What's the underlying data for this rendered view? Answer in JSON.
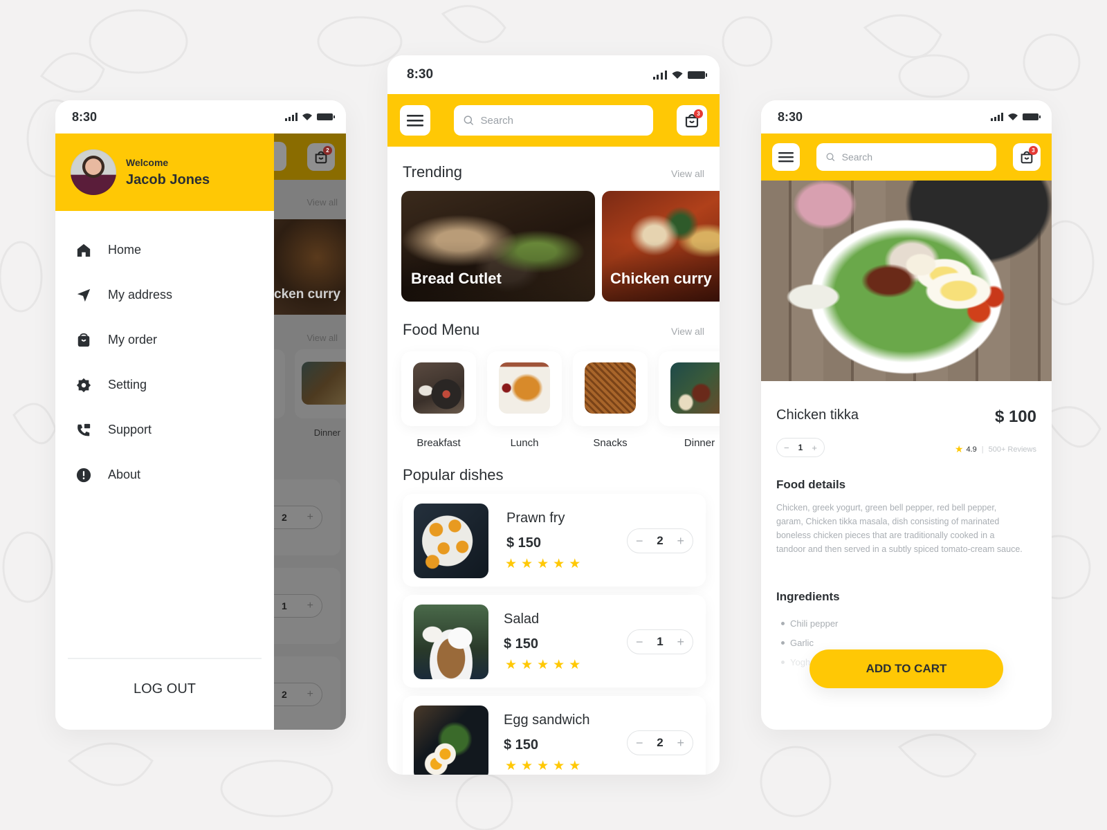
{
  "colors": {
    "accent": "#ffc805",
    "badge": "#e53935",
    "text": "#2b2f33",
    "muted": "#a4a8ac"
  },
  "status": {
    "time": "8:30"
  },
  "drawer_screen": {
    "welcome": "Welcome",
    "user_name": "Jacob Jones",
    "menu": [
      {
        "icon": "home-icon",
        "label": "Home"
      },
      {
        "icon": "navigation-arrow-icon",
        "label": "My address"
      },
      {
        "icon": "shopping-bag-icon",
        "label": "My order"
      },
      {
        "icon": "gear-icon",
        "label": "Setting"
      },
      {
        "icon": "support-phone-icon",
        "label": "Support"
      },
      {
        "icon": "info-exclamation-icon",
        "label": "About"
      }
    ],
    "logout": "LOG OUT",
    "behind": {
      "view_all_1": "View all",
      "view_all_2": "View all",
      "trending_partial": "cken curry",
      "dinner": "Dinner",
      "qtys": [
        "2",
        "1",
        "2"
      ]
    }
  },
  "home_screen": {
    "search_placeholder": "Search",
    "cart_count": "3",
    "trending": {
      "title": "Trending",
      "view_all": "View all",
      "items": [
        {
          "name": "Bread Cutlet"
        },
        {
          "name": "Chicken curry"
        }
      ]
    },
    "food_menu": {
      "title": "Food Menu",
      "view_all": "View all",
      "items": [
        {
          "label": "Breakfast"
        },
        {
          "label": "Lunch"
        },
        {
          "label": "Snacks"
        },
        {
          "label": "Dinner"
        }
      ]
    },
    "popular": {
      "title": "Popular dishes",
      "items": [
        {
          "name": "Prawn fry",
          "price": "$ 150",
          "rating": 5,
          "qty": "2"
        },
        {
          "name": "Salad",
          "price": "$ 150",
          "rating": 5,
          "qty": "1"
        },
        {
          "name": "Egg sandwich",
          "price": "$ 150",
          "rating": 5,
          "qty": "2"
        }
      ]
    },
    "stepper": {
      "minus": "−",
      "plus": "+"
    }
  },
  "detail_screen": {
    "search_placeholder": "Search",
    "cart_count": "3",
    "name": "Chicken tikka",
    "price": "$ 100",
    "qty": "1",
    "rating": "4.9",
    "separator": "|",
    "reviews": "500+ Reviews",
    "details_title": "Food details",
    "details_text": "Chicken, greek yogurt, green bell pepper, red bell pepper, garam, Chicken tikka masala, dish consisting of marinated boneless chicken pieces that are traditionally cooked in a tandoor and then served in a subtly spiced tomato-cream sauce.",
    "ingredients_title": "Ingredients",
    "ingredients": [
      "Chili pepper",
      "Garlic",
      "Yoghurt"
    ],
    "add_to_cart": "ADD TO CART"
  }
}
